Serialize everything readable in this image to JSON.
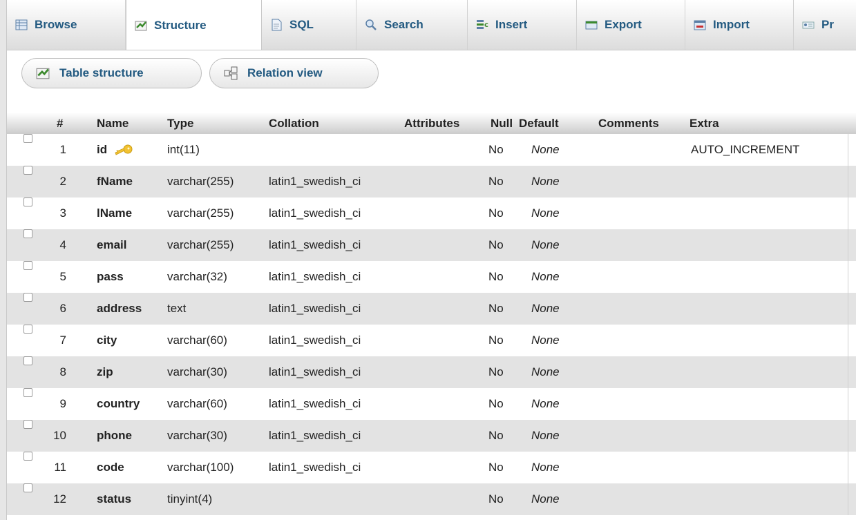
{
  "tabs": [
    {
      "label": "Browse",
      "icon": "browse-icon"
    },
    {
      "label": "Structure",
      "icon": "structure-icon",
      "active": true
    },
    {
      "label": "SQL",
      "icon": "sql-icon"
    },
    {
      "label": "Search",
      "icon": "search-icon"
    },
    {
      "label": "Insert",
      "icon": "insert-icon"
    },
    {
      "label": "Export",
      "icon": "export-icon"
    },
    {
      "label": "Import",
      "icon": "import-icon"
    },
    {
      "label": "Pr",
      "icon": "privileges-icon"
    }
  ],
  "subnav": {
    "table_structure": "Table structure",
    "relation_view": "Relation view"
  },
  "table": {
    "headers": {
      "num": "#",
      "name": "Name",
      "type": "Type",
      "collation": "Collation",
      "attributes": "Attributes",
      "null": "Null",
      "default": "Default",
      "comments": "Comments",
      "extra": "Extra"
    },
    "rows": [
      {
        "num": "1",
        "name": "id",
        "type": "int(11)",
        "collation": "",
        "null": "No",
        "default": "None",
        "extra": "AUTO_INCREMENT",
        "primary_key": true
      },
      {
        "num": "2",
        "name": "fName",
        "type": "varchar(255)",
        "collation": "latin1_swedish_ci",
        "null": "No",
        "default": "None",
        "extra": ""
      },
      {
        "num": "3",
        "name": "lName",
        "type": "varchar(255)",
        "collation": "latin1_swedish_ci",
        "null": "No",
        "default": "None",
        "extra": ""
      },
      {
        "num": "4",
        "name": "email",
        "type": "varchar(255)",
        "collation": "latin1_swedish_ci",
        "null": "No",
        "default": "None",
        "extra": ""
      },
      {
        "num": "5",
        "name": "pass",
        "type": "varchar(32)",
        "collation": "latin1_swedish_ci",
        "null": "No",
        "default": "None",
        "extra": ""
      },
      {
        "num": "6",
        "name": "address",
        "type": "text",
        "collation": "latin1_swedish_ci",
        "null": "No",
        "default": "None",
        "extra": ""
      },
      {
        "num": "7",
        "name": "city",
        "type": "varchar(60)",
        "collation": "latin1_swedish_ci",
        "null": "No",
        "default": "None",
        "extra": ""
      },
      {
        "num": "8",
        "name": "zip",
        "type": "varchar(30)",
        "collation": "latin1_swedish_ci",
        "null": "No",
        "default": "None",
        "extra": ""
      },
      {
        "num": "9",
        "name": "country",
        "type": "varchar(60)",
        "collation": "latin1_swedish_ci",
        "null": "No",
        "default": "None",
        "extra": ""
      },
      {
        "num": "10",
        "name": "phone",
        "type": "varchar(30)",
        "collation": "latin1_swedish_ci",
        "null": "No",
        "default": "None",
        "extra": ""
      },
      {
        "num": "11",
        "name": "code",
        "type": "varchar(100)",
        "collation": "latin1_swedish_ci",
        "null": "No",
        "default": "None",
        "extra": ""
      },
      {
        "num": "12",
        "name": "status",
        "type": "tinyint(4)",
        "collation": "",
        "null": "No",
        "default": "None",
        "extra": ""
      }
    ]
  },
  "colors": {
    "link": "#235a81",
    "row_alt": "#e3e3e3",
    "key_icon": "#f2c232"
  }
}
